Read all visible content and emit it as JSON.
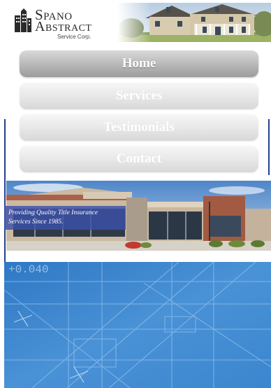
{
  "brand": {
    "line1": "Spano",
    "line2": "Abstract",
    "line3": "Service Corp."
  },
  "nav": {
    "items": [
      {
        "label": "Home",
        "active": true
      },
      {
        "label": "Services",
        "active": false
      },
      {
        "label": "Testimonials",
        "active": false
      },
      {
        "label": "Contact",
        "active": false
      }
    ]
  },
  "banner": {
    "tagline": "Providing Quality Title Insurance Services Since 1985."
  },
  "blueprint": {
    "dimension_text": "+0.040"
  },
  "colors": {
    "accent_blue": "#23408e",
    "blueprint_blue": "#3f86cf"
  }
}
